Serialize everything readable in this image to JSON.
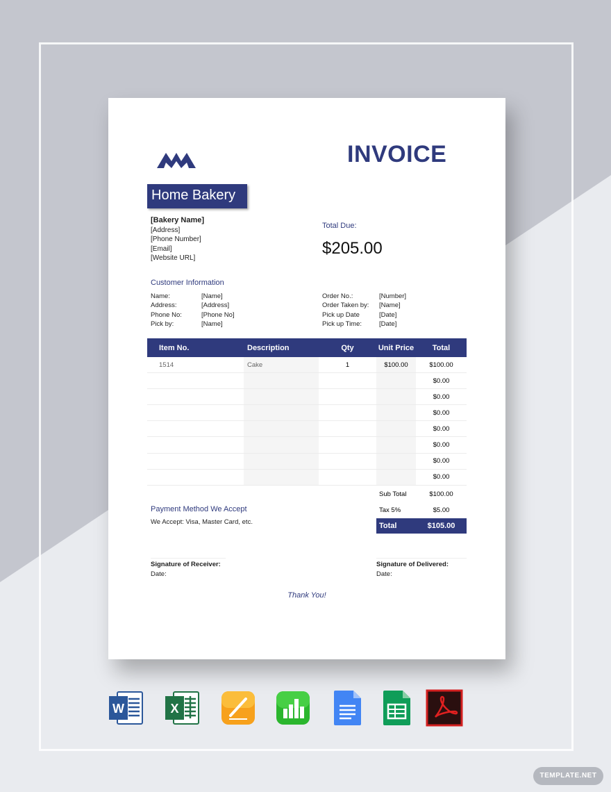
{
  "invoice": {
    "title": "INVOICE",
    "bakery_box": "Home Bakery",
    "bakery_name": "[Bakery Name]",
    "address": "[Address]",
    "phone": "[Phone Number]",
    "email": "[Email]",
    "website": "[Website URL]",
    "total_due_label": "Total Due:",
    "total_due_amount": "$205.00"
  },
  "customer": {
    "heading": "Customer Information",
    "fields": [
      {
        "label": "Name:",
        "value": "[Name]"
      },
      {
        "label": "Address:",
        "value": "[Address]"
      },
      {
        "label": "Phone No:",
        "value": "[Phone No]"
      },
      {
        "label": "Pick by:",
        "value": "[Name]"
      }
    ]
  },
  "order": {
    "fields": [
      {
        "label": "Order No.:",
        "value": "[Number]"
      },
      {
        "label": "Order Taken by:",
        "value": "[Name]"
      },
      {
        "label": "Pick up Date",
        "value": "[Date]"
      },
      {
        "label": "Pick up Time:",
        "value": "[Date]"
      }
    ]
  },
  "table": {
    "headers": [
      "Item No.",
      "Description",
      "Qty",
      "Unit Price",
      "Total"
    ],
    "rows": [
      [
        "1514",
        "Cake",
        "1",
        "$100.00",
        "$100.00"
      ],
      [
        "",
        "",
        "",
        "",
        "$0.00"
      ],
      [
        "",
        "",
        "",
        "",
        "$0.00"
      ],
      [
        "",
        "",
        "",
        "",
        "$0.00"
      ],
      [
        "",
        "",
        "",
        "",
        "$0.00"
      ],
      [
        "",
        "",
        "",
        "",
        "$0.00"
      ],
      [
        "",
        "",
        "",
        "",
        "$0.00"
      ],
      [
        "",
        "",
        "",
        "",
        "$0.00"
      ]
    ]
  },
  "summary": {
    "subtotal_label": "Sub Total",
    "subtotal_value": "$100.00",
    "tax_label": "Tax 5%",
    "tax_value": "$5.00",
    "total_label": "Total",
    "total_value": "$105.00"
  },
  "payment": {
    "heading": "Payment Method We Accept",
    "text": "We Accept: Visa, Master Card, etc."
  },
  "signatures": {
    "receiver_label": "Signature of Receiver:",
    "receiver_date": "Date:",
    "delivered_label": "Signature of Delivered:",
    "delivered_date": "Date:"
  },
  "thanks": "Thank You!",
  "apps": [
    "word-icon",
    "excel-icon",
    "pages-icon",
    "numbers-icon",
    "google-docs-icon",
    "google-sheets-icon",
    "pdf-icon"
  ],
  "watermark": "TEMPLATE.NET",
  "colors": {
    "accent": "#2f3a7d",
    "background": "#e9ebef"
  }
}
